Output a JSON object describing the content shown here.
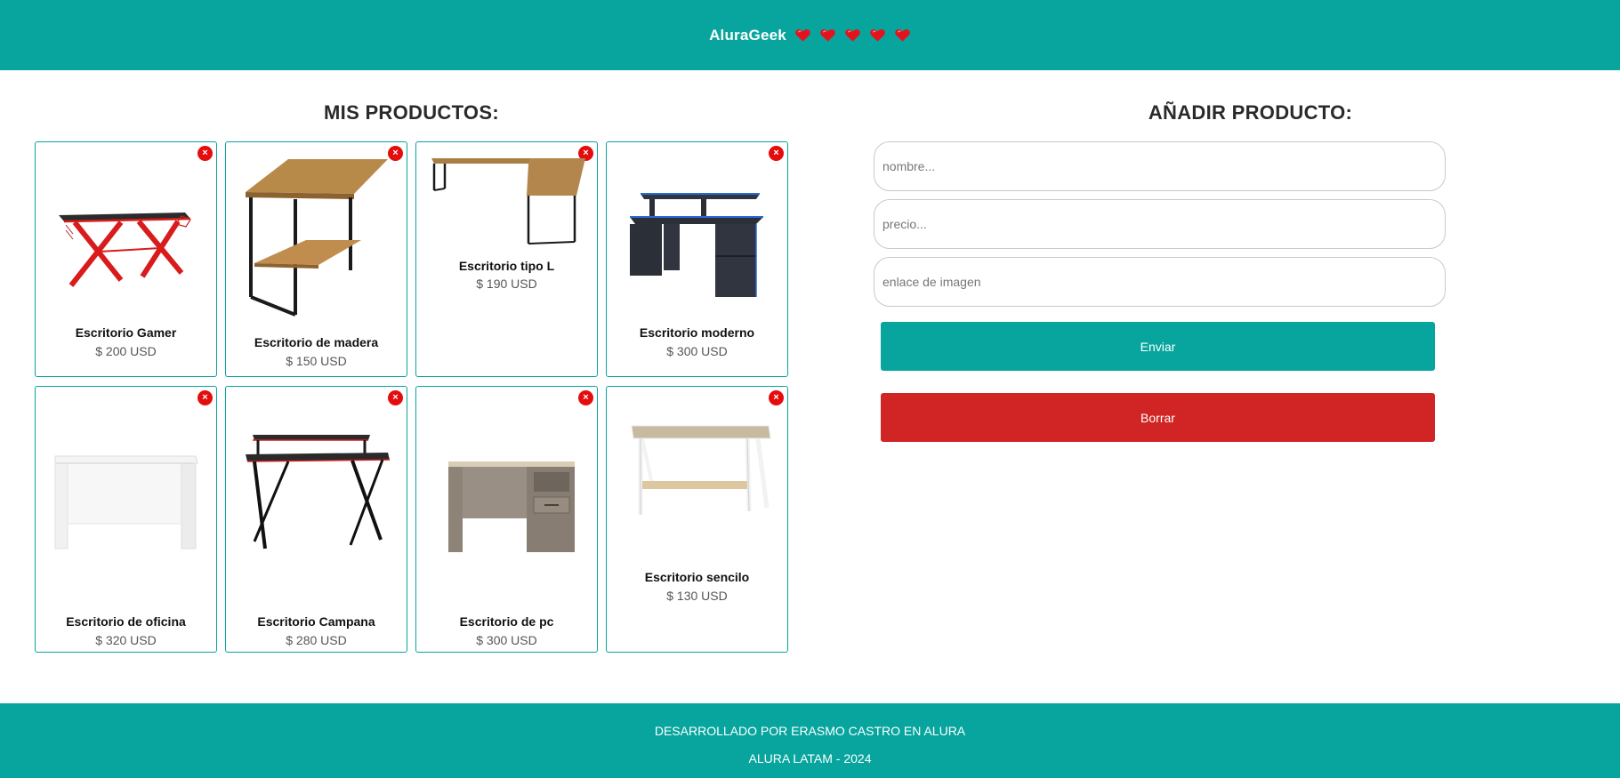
{
  "header": {
    "brand": "AluraGeek",
    "hearts": 5,
    "heart_color": "#e4121d"
  },
  "products_section": {
    "title": "MIS PRODUCTOS:"
  },
  "products": [
    {
      "name": "Escritorio Gamer",
      "price": "$ 200 USD",
      "image": "gamer-desk"
    },
    {
      "name": "Escritorio de madera",
      "price": "$ 150 USD",
      "image": "wood-desk"
    },
    {
      "name": "Escritorio tipo L",
      "price": "$ 190 USD",
      "image": "l-desk"
    },
    {
      "name": "Escritorio moderno",
      "price": "$ 300 USD",
      "image": "modern-desk"
    },
    {
      "name": "Escritorio de oficina",
      "price": "$ 320 USD",
      "image": "office-desk"
    },
    {
      "name": "Escritorio Campana",
      "price": "$ 280 USD",
      "image": "campana-desk"
    },
    {
      "name": "Escritorio de pc",
      "price": "$ 300 USD",
      "image": "pc-desk"
    },
    {
      "name": "Escritorio sencilo",
      "price": "$ 130 USD",
      "image": "simple-desk"
    }
  ],
  "close_icon": "×",
  "form": {
    "title": "AÑADIR PRODUCTO:",
    "name_placeholder": "nombre...",
    "price_placeholder": "precio...",
    "image_placeholder": "enlace de imagen",
    "send_label": "Enviar",
    "clear_label": "Borrar"
  },
  "footer": {
    "line1": "DESARROLLADO POR ERASMO CASTRO EN ALURA",
    "line2": "ALURA LATAM - 2024"
  },
  "colors": {
    "accent": "#07a59e",
    "danger": "#d12525"
  }
}
